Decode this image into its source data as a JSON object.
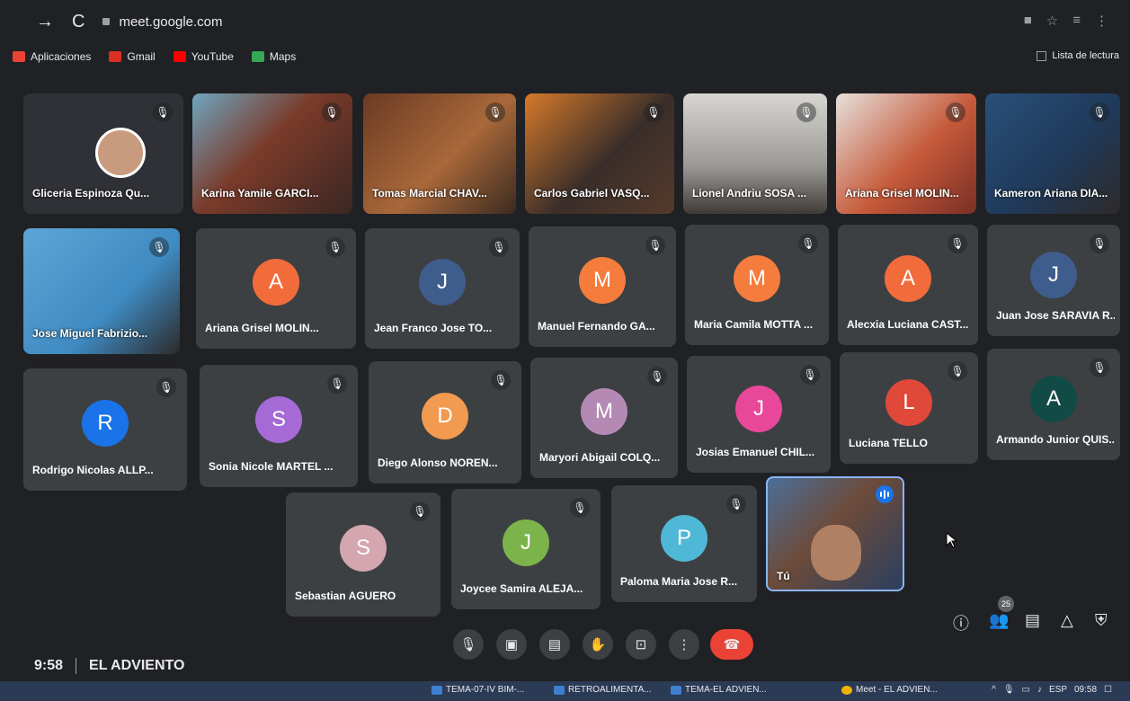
{
  "browser": {
    "url": "meet.google.com",
    "bookmarks": [
      {
        "label": "Aplicaciones",
        "color": "#ea4335"
      },
      {
        "label": "Gmail",
        "color": "#d93025"
      },
      {
        "label": "YouTube",
        "color": "#ff0000"
      },
      {
        "label": "Maps",
        "color": "#34a853"
      }
    ],
    "reading_list": "Lista de lectura"
  },
  "participants": [
    {
      "name": "Gliceria Espinoza Qu...",
      "initial": "",
      "color": "",
      "video": "profile"
    },
    {
      "name": "Karina Yamile GARCI...",
      "initial": "",
      "color": "",
      "video": "camera"
    },
    {
      "name": "Tomas Marcial CHAV...",
      "initial": "",
      "color": "",
      "video": "camera"
    },
    {
      "name": "Carlos Gabriel VASQ...",
      "initial": "",
      "color": "",
      "video": "camera"
    },
    {
      "name": "Lionel Andriu SOSA ...",
      "initial": "",
      "color": "",
      "video": "camera"
    },
    {
      "name": "Ariana Grisel MOLIN...",
      "initial": "",
      "color": "",
      "video": "camera"
    },
    {
      "name": "Kameron Ariana DIA...",
      "initial": "",
      "color": "",
      "video": "camera"
    },
    {
      "name": "Jose Miguel Fabrizio...",
      "initial": "",
      "color": "",
      "video": "camera"
    },
    {
      "name": "Ariana Grisel MOLIN...",
      "initial": "A",
      "color": "#f26b3a"
    },
    {
      "name": "Jean Franco Jose TO...",
      "initial": "J",
      "color": "#3f5d8c"
    },
    {
      "name": "Manuel Fernando GA...",
      "initial": "M",
      "color": "#f47c3c"
    },
    {
      "name": "Maria Camila MOTTA ...",
      "initial": "M",
      "color": "#f47c3c"
    },
    {
      "name": "Alecxia Luciana CAST...",
      "initial": "A",
      "color": "#f26b3a"
    },
    {
      "name": "Juan Jose SARAVIA R...",
      "initial": "J",
      "color": "#3f5d8c"
    },
    {
      "name": "Rodrigo Nicolas ALLP...",
      "initial": "R",
      "color": "#1a73e8"
    },
    {
      "name": "Sonia Nicole MARTEL ...",
      "initial": "S",
      "color": "#a56ad6"
    },
    {
      "name": "Diego Alonso NOREN...",
      "initial": "D",
      "color": "#f29a50"
    },
    {
      "name": "Maryori Abigail COLQ...",
      "initial": "M",
      "color": "#b48ab4"
    },
    {
      "name": "Josias Emanuel CHIL...",
      "initial": "J",
      "color": "#e8479a"
    },
    {
      "name": "Luciana TELLO",
      "initial": "L",
      "color": "#e0483a"
    },
    {
      "name": "Armando Junior QUIS...",
      "initial": "A",
      "color": "#124b45"
    },
    {
      "name": "Sebastian AGUERO",
      "initial": "S",
      "color": "#d4a6b0"
    },
    {
      "name": "Joycee Samira ALEJA...",
      "initial": "J",
      "color": "#7cb34a"
    },
    {
      "name": "Paloma Maria Jose R...",
      "initial": "P",
      "color": "#4fb8d6"
    },
    {
      "name": "Tú",
      "initial": "",
      "color": "",
      "video": "self"
    }
  ],
  "meeting": {
    "time": "9:58",
    "title": "EL ADVIENTO",
    "participant_count": "25",
    "muted_icon": "mic-off-icon"
  },
  "controls": [
    "mic-icon",
    "camera-icon",
    "captions-icon",
    "raise-hand-icon",
    "present-icon",
    "more-icon",
    "end-call-icon"
  ],
  "taskbar": {
    "items": [
      "TEMA-07-IV BIM-...",
      "RETROALIMENTA...",
      "TEMA-EL ADVIEN...",
      "Meet - EL ADVIEN..."
    ],
    "lang": "ESP",
    "clock": "09:58"
  }
}
